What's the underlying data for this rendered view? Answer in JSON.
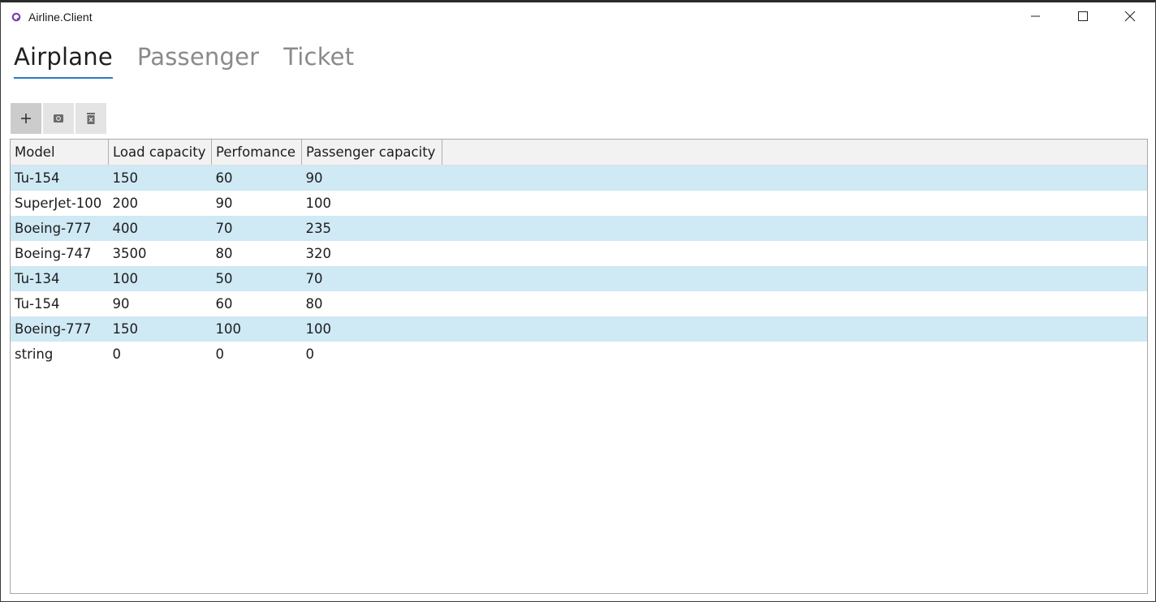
{
  "window": {
    "title": "Airline.Client",
    "accent_color": "#2a7ac8",
    "row_highlight_color": "#cfe9f5"
  },
  "tabs": [
    {
      "label": "Airplane",
      "active": true
    },
    {
      "label": "Passenger",
      "active": false
    },
    {
      "label": "Ticket",
      "active": false
    }
  ],
  "toolbar": {
    "add_icon": "plus-icon",
    "edit_icon": "camera-icon",
    "delete_icon": "delete-icon"
  },
  "table": {
    "headers": [
      "Model",
      "Load capacity",
      "Perfomance",
      "Passenger capacity"
    ],
    "rows": [
      [
        "Tu-154",
        "150",
        "60",
        "90"
      ],
      [
        "SuperJet-100",
        "200",
        "90",
        "100"
      ],
      [
        "Boeing-777",
        "400",
        "70",
        "235"
      ],
      [
        "Boeing-747",
        "3500",
        "80",
        "320"
      ],
      [
        "Tu-134",
        "100",
        "50",
        "70"
      ],
      [
        "Tu-154",
        "90",
        "60",
        "80"
      ],
      [
        "Boeing-777",
        "150",
        "100",
        "100"
      ],
      [
        "string",
        "0",
        "0",
        "0"
      ]
    ]
  }
}
